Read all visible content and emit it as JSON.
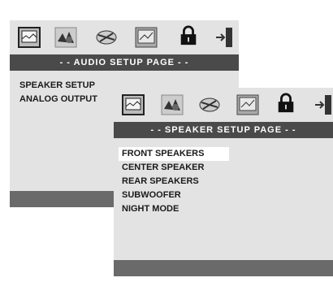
{
  "audio_page": {
    "title": "- -  AUDIO  SETUP  PAGE  - -",
    "items": [
      "SPEAKER SETUP",
      "ANALOG OUTPUT"
    ]
  },
  "speaker_page": {
    "title": "- -  SPEAKER  SETUP  PAGE  - -",
    "items": [
      "FRONT SPEAKERS",
      "CENTER SPEAKER",
      "REAR SPEAKERS",
      "SUBWOOFER",
      "NIGHT MODE"
    ],
    "selected_index": 0
  },
  "toolbar_icons": [
    "general-setup-icon",
    "audio-setup-icon",
    "video-setup-icon",
    "preference-icon",
    "password-lock-icon",
    "exit-icon"
  ],
  "colors": {
    "panel": "#e3e3e3",
    "header": "#4a4a4a",
    "footer": "#6a6a6a",
    "selection": "#ffffff"
  }
}
